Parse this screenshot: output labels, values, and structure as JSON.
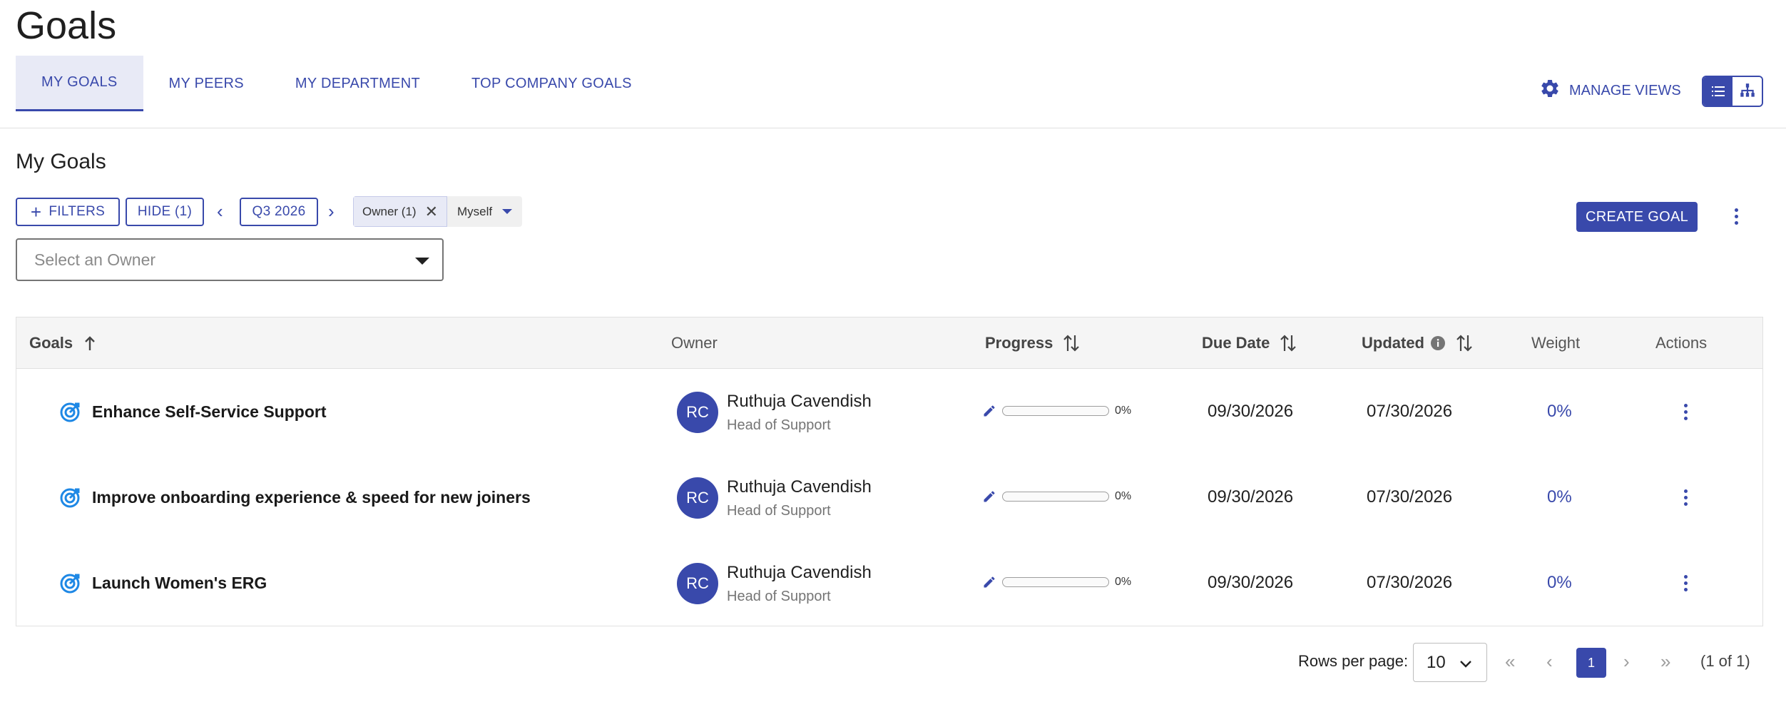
{
  "page": {
    "title": "Goals"
  },
  "tabs": [
    {
      "label": "MY GOALS",
      "active": true
    },
    {
      "label": "MY PEERS",
      "active": false
    },
    {
      "label": "MY DEPARTMENT",
      "active": false
    },
    {
      "label": "TOP COMPANY GOALS",
      "active": false
    }
  ],
  "header": {
    "manage_views": "MANAGE VIEWS",
    "view_mode": "list"
  },
  "section": {
    "title": "My Goals"
  },
  "filters": {
    "filters_label": "FILTERS",
    "hide_label": "HIDE (1)",
    "period": "Q3 2026",
    "chip_label": "Owner (1)",
    "chip_value": "Myself",
    "owner_placeholder": "Select an Owner"
  },
  "actions": {
    "create_goal": "CREATE GOAL"
  },
  "table": {
    "headers": {
      "goals": "Goals",
      "owner": "Owner",
      "progress": "Progress",
      "due_date": "Due Date",
      "updated": "Updated",
      "weight": "Weight",
      "actions": "Actions"
    },
    "rows": [
      {
        "goal": "Enhance Self-Service Support",
        "owner_initials": "RC",
        "owner_name": "Ruthuja Cavendish",
        "owner_role": "Head of Support",
        "progress_value": 0,
        "progress": "0%",
        "due_date": "09/30/2026",
        "updated": "07/30/2026",
        "weight": "0%"
      },
      {
        "goal": "Improve onboarding experience & speed for new joiners",
        "owner_initials": "RC",
        "owner_name": "Ruthuja Cavendish",
        "owner_role": "Head of Support",
        "progress_value": 0,
        "progress": "0%",
        "due_date": "09/30/2026",
        "updated": "07/30/2026",
        "weight": "0%"
      },
      {
        "goal": "Launch Women's ERG",
        "owner_initials": "RC",
        "owner_name": "Ruthuja Cavendish",
        "owner_role": "Head of Support",
        "progress_value": 0,
        "progress": "0%",
        "due_date": "09/30/2026",
        "updated": "07/30/2026",
        "weight": "0%"
      }
    ]
  },
  "pagination": {
    "rows_per_page_label": "Rows per page:",
    "rows_per_page": "10",
    "current_page": "1",
    "summary": "(1 of 1)"
  },
  "colors": {
    "accent": "#3949ab",
    "tab_active_bg": "#e8eaf6",
    "header_bg": "#f5f5f5"
  }
}
